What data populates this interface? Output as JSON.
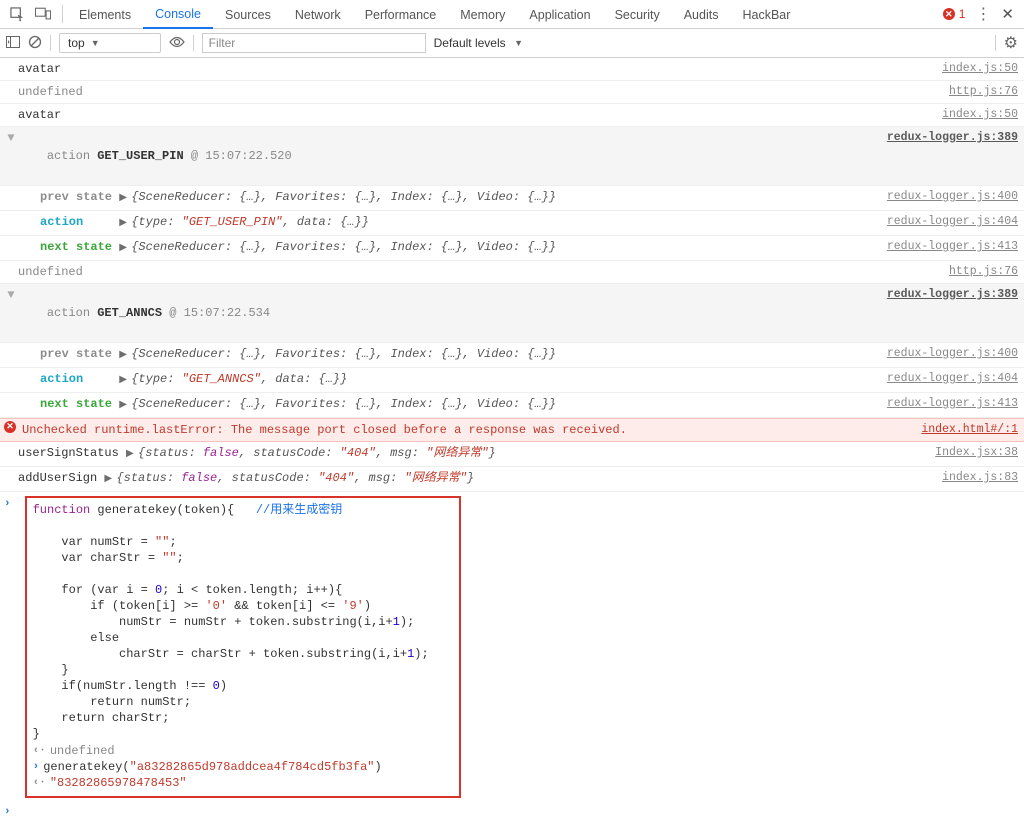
{
  "topbar": {
    "tabs": [
      "Elements",
      "Console",
      "Sources",
      "Network",
      "Performance",
      "Memory",
      "Application",
      "Security",
      "Audits",
      "HackBar"
    ],
    "active_tab": 1,
    "error_count": "1"
  },
  "toolbar": {
    "context": "top",
    "filter_placeholder": "Filter",
    "levels_label": "Default levels"
  },
  "rows": {
    "r0": {
      "text": "avatar",
      "src": "index.js:50"
    },
    "r1": {
      "text": "undefined",
      "src": "http.js:76"
    },
    "r2": {
      "text": "avatar",
      "src": "index.js:50"
    },
    "grp1": {
      "prefix": "action ",
      "name": "GET_USER_PIN",
      "ts": "@ 15:07:22.520",
      "src": "redux-logger.js:389"
    },
    "g1a": {
      "label": "prev state",
      "body": "{SceneReducer: {…}, Favorites: {…}, Index: {…}, Video: {…}}",
      "src": "redux-logger.js:400"
    },
    "g1b": {
      "label": "action",
      "body_pre": "{type: ",
      "body_str": "\"GET_USER_PIN\"",
      "body_post": ", data: {…}}",
      "src": "redux-logger.js:404"
    },
    "g1c": {
      "label": "next state",
      "body": "{SceneReducer: {…}, Favorites: {…}, Index: {…}, Video: {…}}",
      "src": "redux-logger.js:413"
    },
    "r3": {
      "text": "undefined",
      "src": "http.js:76"
    },
    "grp2": {
      "prefix": "action ",
      "name": "GET_ANNCS",
      "ts": "@ 15:07:22.534",
      "src": "redux-logger.js:389"
    },
    "g2a": {
      "label": "prev state",
      "body": "{SceneReducer: {…}, Favorites: {…}, Index: {…}, Video: {…}}",
      "src": "redux-logger.js:400"
    },
    "g2b": {
      "label": "action",
      "body_pre": "{type: ",
      "body_str": "\"GET_ANNCS\"",
      "body_post": ", data: {…}}",
      "src": "redux-logger.js:404"
    },
    "g2c": {
      "label": "next state",
      "body": "{SceneReducer: {…}, Favorites: {…}, Index: {…}, Video: {…}}",
      "src": "redux-logger.js:413"
    },
    "err": {
      "text": "Unchecked runtime.lastError: The message port closed before a response was received.",
      "src": "index.html#/:1"
    },
    "sign1": {
      "label": "userSignStatus",
      "status_code": "\"404\"",
      "msg": "\"网络异常\"",
      "src": "Index.jsx:38"
    },
    "sign2": {
      "label": "addUserSign",
      "status_code": "\"404\"",
      "msg": "\"网络异常\"",
      "src": "index.js:83"
    }
  },
  "code": {
    "comment": "//用来生成密钥",
    "undef": "undefined",
    "call_fn": "generatekey(",
    "call_arg": "\"a83282865d978addcea4f784cd5fb3fa\"",
    "call_close": ")",
    "result": "\"83282865978478453\"",
    "lines": {
      "l1a": "function",
      "l1b": " generatekey(token){   ",
      "l3": "    var numStr = ",
      "l3s": "\"\"",
      "l3e": ";",
      "l4": "    var charStr = ",
      "l4s": "\"\"",
      "l4e": ";",
      "l6a": "    for (var i = ",
      "l6n0": "0",
      "l6b": "; i < token.length; i++){",
      "l7a": "        if (token[i] >= ",
      "l7s1": "'0'",
      "l7b": " && token[i] <= ",
      "l7s2": "'9'",
      "l7c": ")",
      "l8a": "            numStr = numStr + token.substring(i,i+",
      "l8n": "1",
      "l8b": ");",
      "l9": "        else",
      "l10a": "            charStr = charStr + token.substring(i,i+",
      "l10n": "1",
      "l10b": ");",
      "l11": "    }",
      "l12a": "    if(numStr.length !== ",
      "l12n": "0",
      "l12b": ")",
      "l13": "        return numStr;",
      "l14": "    return charStr;",
      "l15": "}"
    }
  }
}
